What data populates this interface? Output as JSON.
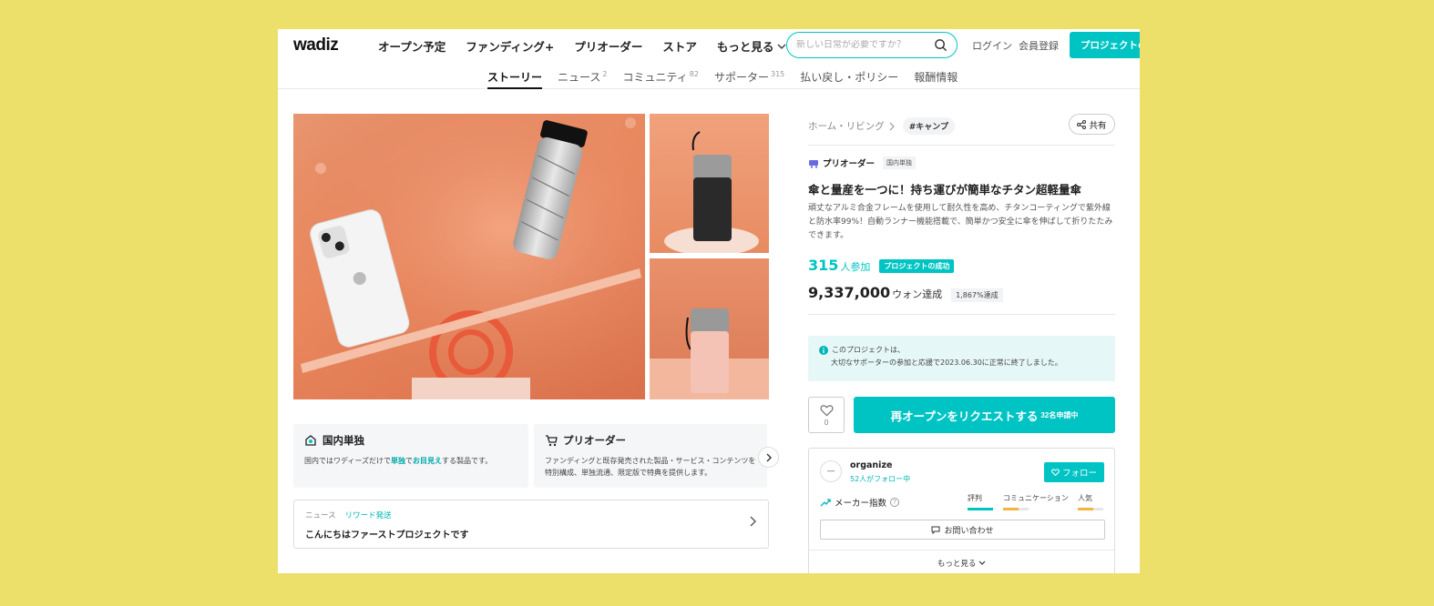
{
  "header": {
    "logo": "wadiz",
    "nav": [
      "オープン予定",
      "ファンディング+",
      "プリオーダー",
      "ストア",
      "もっと見る"
    ],
    "search_placeholder": "新しい日常が必要ですか？",
    "login": "ログイン",
    "signup": "会員登録",
    "make_project": "プロジェクトの"
  },
  "tabs": [
    {
      "label": "ストーリー",
      "count": ""
    },
    {
      "label": "ニュース",
      "count": "2"
    },
    {
      "label": "コミュニティ",
      "count": "82"
    },
    {
      "label": "サポーター",
      "count": "315"
    },
    {
      "label": "払い戻し・ポリシー",
      "count": ""
    },
    {
      "label": "報酬情報",
      "count": ""
    }
  ],
  "features": [
    {
      "title": "国内単独",
      "desc_before": "国内ではワディーズだけで",
      "desc_hl1": "単独",
      "desc_mid": "で",
      "desc_hl2": "お目見え",
      "desc_after": "する製品です。"
    },
    {
      "title": "プリオーダー",
      "desc_line1": "ファンディングと既存発売された製品・サービス・コンテンツを",
      "desc_line2": "特別構成、単独流通、限定版で特典を提供します。"
    }
  ],
  "news": {
    "label": "ニュース",
    "tag": "リワード発送",
    "title": "こんにちはファーストプロジェクトです"
  },
  "breadcrumb": {
    "path": "ホーム・リビング",
    "hashtag": "#キャンプ",
    "share": "共有"
  },
  "project": {
    "type": "プリオーダー",
    "badge": "国内単独",
    "title": "傘と量産を一つに！持ち運びが簡単なチタン超軽量傘",
    "description": "頑丈なアルミ合金フレームを使用して耐久性を高め、チタンコーティングで紫外線と防水率99%！自動ランナー機能搭載で、簡単かつ安全に傘を伸ばして折りたたみできます。",
    "supporters": "315",
    "supporters_unit": "人参加",
    "success_badge": "プロジェクトの成功",
    "amount": "9,337,000",
    "amount_unit": "ウォン達成",
    "rate": "1,867%達成"
  },
  "notice": {
    "line1": "このプロジェクトは、",
    "line2": "大切なサポーターの参加と応援で2023.06.30に正常に終了しました。"
  },
  "actions": {
    "like_count": "0",
    "reopen": "再オープンをリクエストする",
    "reopen_count": "32名申請中"
  },
  "maker": {
    "name": "organize",
    "followers": "52人がフォロー中",
    "follow": "フォロー",
    "index_label": "メーカー指数",
    "metrics": [
      {
        "label": "評判",
        "level": 1.0,
        "color": "#00c4c4"
      },
      {
        "label": "コミュニケーション",
        "level": 0.6,
        "color": "#f5b342"
      },
      {
        "label": "人気",
        "level": 0.6,
        "color": "#f5b342"
      }
    ],
    "inquiry": "お問い合わせ",
    "more": "もっと見る"
  }
}
